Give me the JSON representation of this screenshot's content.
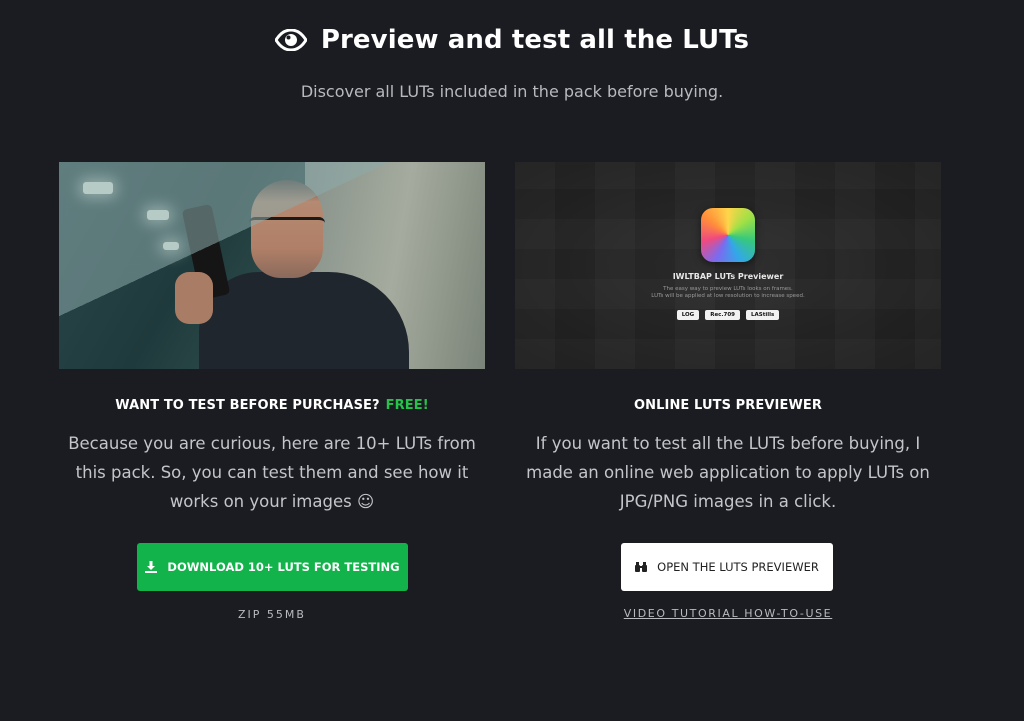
{
  "header": {
    "title": "Preview and test all the LUTs",
    "subtitle": "Discover all LUTs included in the pack before buying.",
    "title_icon": "eye-icon"
  },
  "left_card": {
    "heading": "WANT TO TEST BEFORE PURCHASE?",
    "heading_badge": "FREE!",
    "text": "Because you are curious, here are 10+ LUTs from this pack. So, you can test them and see how it works on your images ☺",
    "button_label": "DOWNLOAD 10+ LUTS FOR TESTING",
    "button_icon": "download-icon",
    "file_info": "ZIP 55MB"
  },
  "right_card": {
    "heading": "ONLINE LUTS PREVIEWER",
    "text": "If you want to test all the LUTs before buying, I made an online web application to apply LUTs on JPG/PNG images in a click.",
    "button_label": "OPEN THE LUTS PREVIEWER",
    "button_icon": "binoculars-icon",
    "link_label": "VIDEO TUTORIAL HOW-TO-USE",
    "preview": {
      "app_title": "IWLTBAP LUTs Previewer",
      "app_desc_1": "The easy way to preview LUTs looks on frames.",
      "app_desc_2": "LUTs will be applied at low resolution to increase speed.",
      "buttons": [
        "LOG",
        "Rec.709",
        "LAStills"
      ]
    }
  },
  "colors": {
    "background": "#1b1c22",
    "accent_green": "#12b34a",
    "free_green": "#27c24c"
  }
}
